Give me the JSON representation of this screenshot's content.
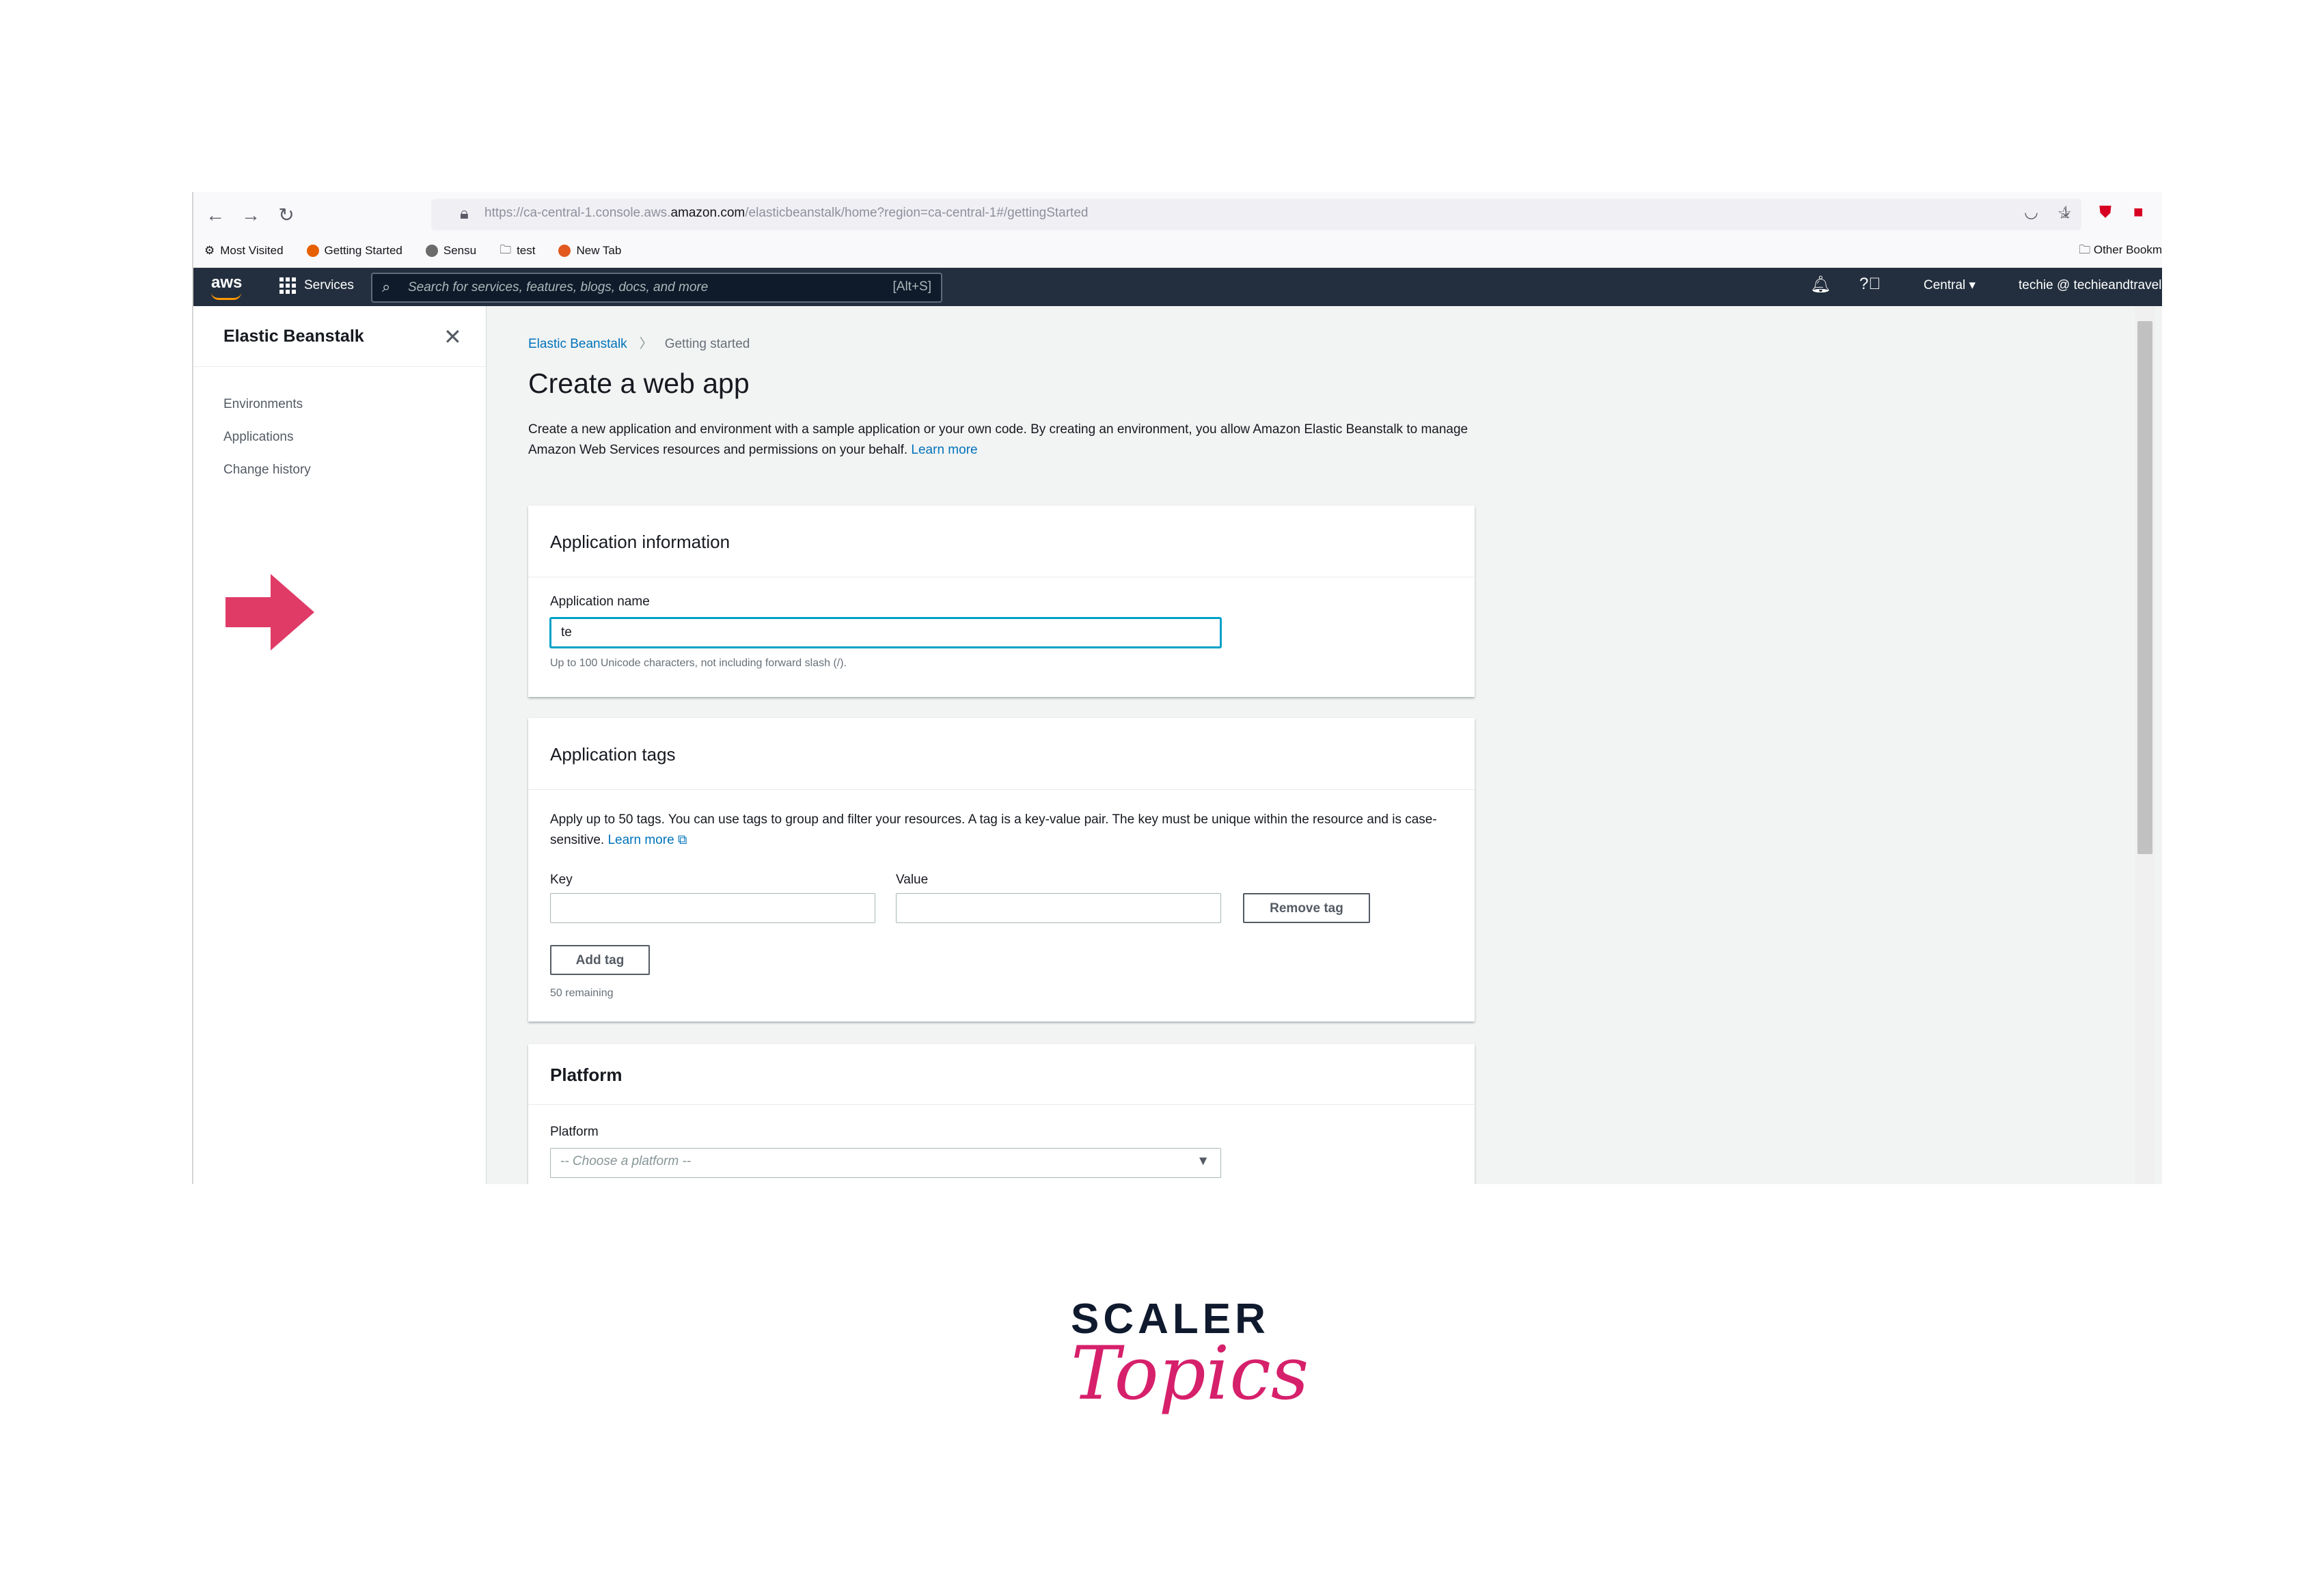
{
  "browser": {
    "url_prefix": "https://ca-central-1.console.aws.",
    "url_domain": "amazon.com",
    "url_suffix": "/elasticbeanstalk/home?region=ca-central-1#/gettingStarted",
    "bookmarks": [
      "Most Visited",
      "Getting Started",
      "Sensu",
      "test",
      "New Tab"
    ],
    "other_bookmarks": "Other Bookm"
  },
  "aws_nav": {
    "logo": "aws",
    "services_label": "Services",
    "search_placeholder": "Search for services, features, blogs, docs, and more",
    "search_shortcut": "[Alt+S]",
    "region": "Central ▾",
    "account": "techie @ techieandtravel ▾"
  },
  "sidebar": {
    "title": "Elastic Beanstalk",
    "items": [
      {
        "label": "Environments"
      },
      {
        "label": "Applications"
      },
      {
        "label": "Change history"
      }
    ]
  },
  "breadcrumb": {
    "parent": "Elastic Beanstalk",
    "current": "Getting started"
  },
  "page": {
    "title": "Create a web app",
    "intro": "Create a new application and environment with a sample application or your own code. By creating an environment, you allow Amazon Elastic Beanstalk to manage Amazon Web Services resources and permissions on your behalf.",
    "learn_more": "Learn more"
  },
  "app_info": {
    "heading": "Application information",
    "name_label": "Application name",
    "name_value": "te",
    "name_hint": "Up to 100 Unicode characters, not including forward slash (/)."
  },
  "app_tags": {
    "heading": "Application tags",
    "description": "Apply up to 50 tags. You can use tags to group and filter your resources. A tag is a key-value pair. The key must be unique within the resource and is case-sensitive.",
    "learn_more": "Learn more",
    "key_label": "Key",
    "value_label": "Value",
    "remove_button": "Remove tag",
    "add_button": "Add tag",
    "remaining": "50 remaining"
  },
  "platform": {
    "heading": "Platform",
    "label": "Platform",
    "placeholder": "-- Choose a platform --"
  },
  "branding": {
    "top": "SCALER",
    "bottom": "Topics"
  }
}
